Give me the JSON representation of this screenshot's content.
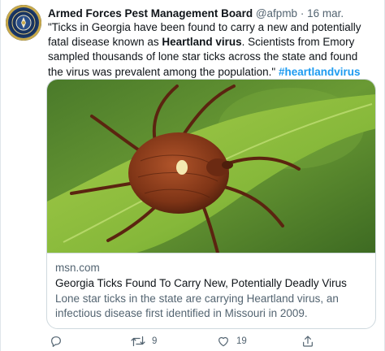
{
  "author": {
    "name": "Armed Forces Pest Management Board",
    "handle": "@afpmb",
    "separator": "·",
    "date": "16 mar."
  },
  "tweet": {
    "text_part1": "\"Ticks in Georgia have been found to carry a new and potentially fatal disease known as ",
    "text_bold": "Heartland virus",
    "text_part2": ". Scientists from Emory sampled thousands of lone star ticks across the state and found the virus was prevalent among the population.\" ",
    "hashtag": "#heartlandvirus"
  },
  "card": {
    "domain": "msn.com",
    "title": "Georgia Ticks Found To Carry New, Potentially Deadly Virus",
    "description": "Lone star ticks in the state are carrying Heartland virus, an infectious disease first identified in Missouri in 2009."
  },
  "actions": {
    "reply_count": "",
    "retweet_count": "9",
    "like_count": "19",
    "share_count": ""
  },
  "colors": {
    "accent": "#1d9bf0",
    "secondary_text": "#536471",
    "border": "#cfd9de"
  }
}
